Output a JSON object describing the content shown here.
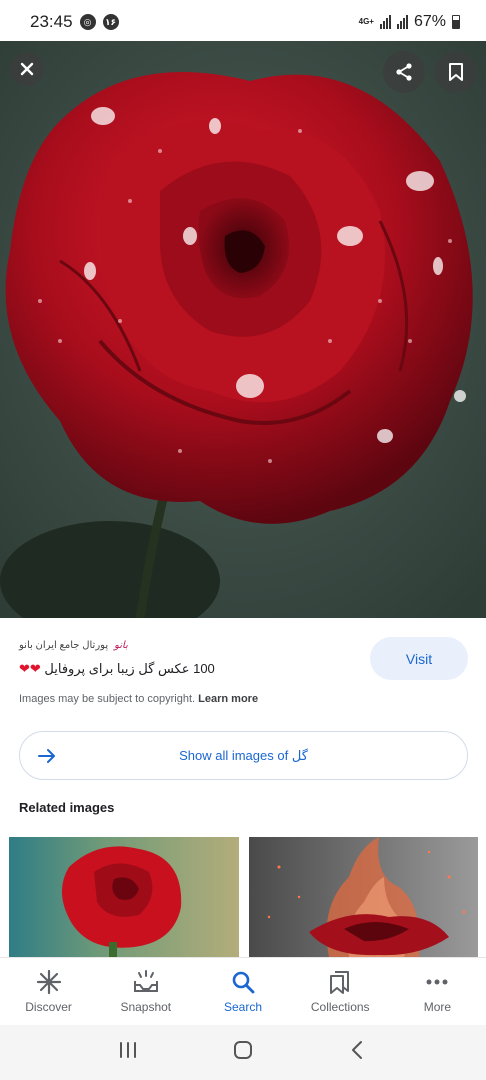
{
  "status_bar": {
    "time": "23:45",
    "notif_badge": "۱۶",
    "network": "4G+",
    "battery": "67%"
  },
  "hero": {
    "icons": {
      "close": "close-icon",
      "share": "share-icon",
      "bookmark": "bookmark-icon"
    }
  },
  "result": {
    "source_logo": "بانو",
    "source_name": "پورتال جامع ایران بانو",
    "title": "100 عکس گل زیبا برای پروفایل",
    "title_hearts": "❤❤",
    "visit_label": "Visit",
    "copyright_text": "Images may be subject to copyright.",
    "learn_more": "Learn more"
  },
  "show_all": {
    "label": "Show all images of",
    "query": "گل"
  },
  "related": {
    "title": "Related images"
  },
  "bottom_nav": {
    "items": [
      {
        "label": "Discover",
        "icon": "asterisk-icon"
      },
      {
        "label": "Snapshot",
        "icon": "snapshot-icon"
      },
      {
        "label": "Search",
        "icon": "search-icon",
        "active": true
      },
      {
        "label": "Collections",
        "icon": "collections-icon"
      },
      {
        "label": "More",
        "icon": "more-dots-icon"
      }
    ]
  },
  "colors": {
    "accent": "#1a66d2",
    "visit_bg": "#e9f0fb",
    "rose": "#b10f1e"
  }
}
